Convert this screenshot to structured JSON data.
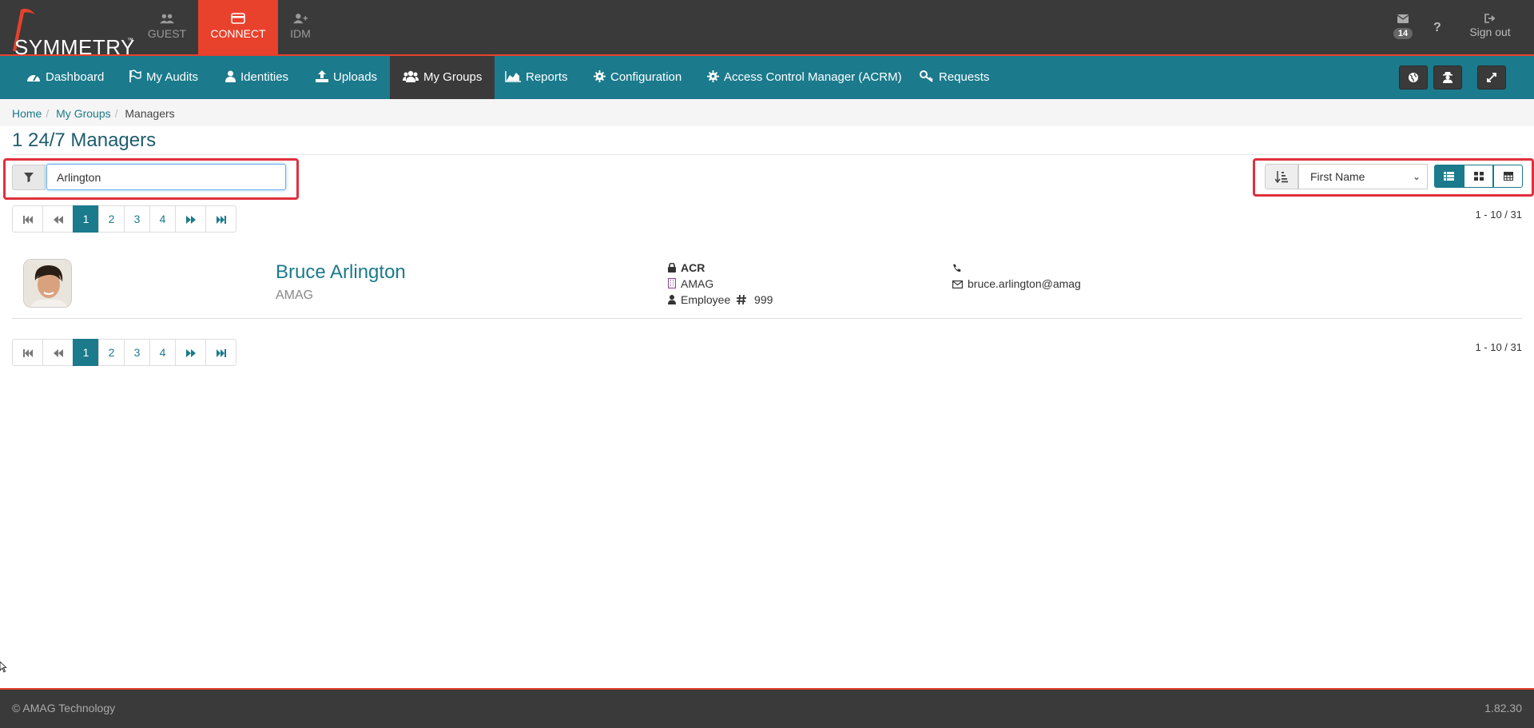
{
  "header": {
    "logo_text": "SYMMETRY",
    "logo_tm": "™",
    "apps": [
      {
        "label": "GUEST",
        "icon": "users-icon"
      },
      {
        "label": "CONNECT",
        "icon": "card-icon",
        "active": true
      },
      {
        "label": "IDM",
        "icon": "user-plus-icon"
      }
    ],
    "mail_count": "14",
    "help_label": "?",
    "signout_label": "Sign out"
  },
  "nav": {
    "items": [
      {
        "label": "Dashboard",
        "icon": "dashboard-icon"
      },
      {
        "label": "My Audits",
        "icon": "flag-icon"
      },
      {
        "label": "Identities",
        "icon": "user-icon"
      },
      {
        "label": "Uploads",
        "icon": "upload-icon"
      },
      {
        "label": "My Groups",
        "icon": "group-icon",
        "active": true
      },
      {
        "label": "Reports",
        "icon": "area-chart-icon"
      },
      {
        "label": "Configuration",
        "icon": "gear-icon"
      },
      {
        "label": "Access Control Manager (ACRM)",
        "icon": "gear-icon"
      },
      {
        "label": "Requests",
        "icon": "key-icon"
      }
    ],
    "right_buttons": [
      "globe-icon",
      "user-secret-icon",
      "expand-icon"
    ]
  },
  "breadcrumb": {
    "items": [
      "Home",
      "My Groups"
    ],
    "current": "Managers"
  },
  "page": {
    "title": "1 24/7 Managers"
  },
  "filter": {
    "value": "Arlington"
  },
  "sort": {
    "selected": "First Name"
  },
  "pagination": {
    "pages": [
      "1",
      "2",
      "3",
      "4"
    ],
    "active_page": "1",
    "range_text": "1 - 10 / 31"
  },
  "record": {
    "name": "Bruce Arlington",
    "organization": "AMAG",
    "access_level": "ACR",
    "company": "AMAG",
    "employee_label": "Employee",
    "employee_number": "999",
    "phone": "",
    "email": "bruce.arlington@amag"
  },
  "footer": {
    "copyright": "© AMAG Technology",
    "version": "1.82.30"
  }
}
